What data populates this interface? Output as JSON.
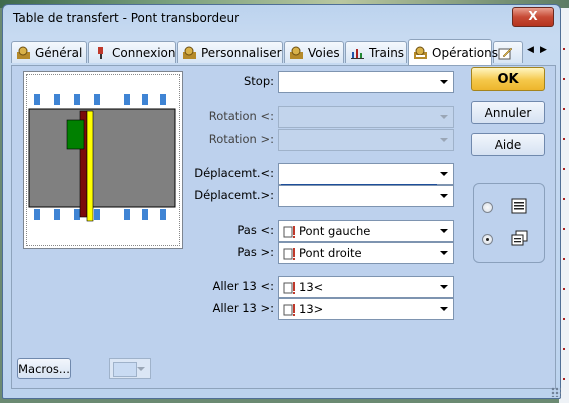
{
  "window": {
    "title": "Table de transfert - Pont transbordeur",
    "close_label": "X"
  },
  "tabs": [
    {
      "label": "Général",
      "icon": "gear-icon"
    },
    {
      "label": "Connexion",
      "icon": "plug-icon"
    },
    {
      "label": "Personnaliser",
      "icon": "gear-icon"
    },
    {
      "label": "Voies",
      "icon": "gear-icon"
    },
    {
      "label": "Trains",
      "icon": "chart-icon"
    },
    {
      "label": "Opérations",
      "icon": "operations-icon",
      "active": true
    }
  ],
  "form": {
    "stop_label": "Stop:",
    "rotation_left_label": "Rotation <:",
    "rotation_right_label": "Rotation >:",
    "move_left_label": "Déplacemt.<:",
    "move_right_label": "Déplacemt.>:",
    "step_left_label": "Pas <:",
    "step_left_value": "Pont gauche",
    "step_right_label": "Pas >:",
    "step_right_value": "Pont droite",
    "goto_left_label": "Aller 13 <:",
    "goto_left_value": "13<",
    "goto_right_label": "Aller 13 >:",
    "goto_right_value": "13>"
  },
  "buttons": {
    "ok": "OK",
    "cancel": "Annuler",
    "help": "Aide",
    "macros": "Macros..."
  },
  "view_options": {
    "selected": "grid-view"
  },
  "colors": {
    "accent_ok": "#f5c84a",
    "panel": "#bdd1ed",
    "rail_red": "#7a0b0b",
    "rail_yellow": "#ffff00",
    "cab_green": "#008000"
  }
}
